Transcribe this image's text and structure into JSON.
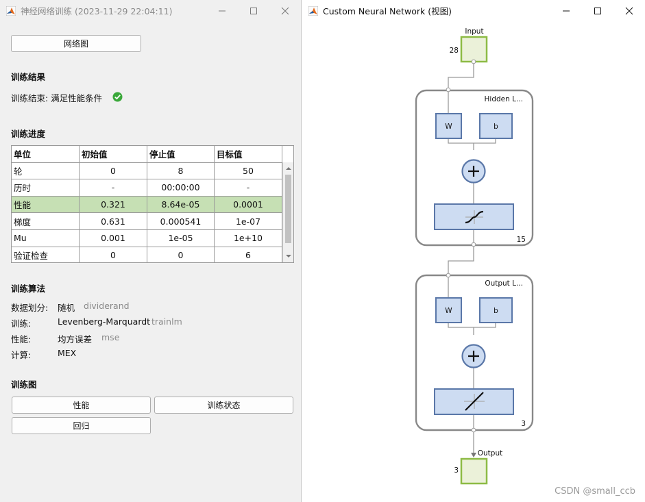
{
  "left_window": {
    "title": "神经网络训练 (2023-11-29 22:04:11)",
    "network_button": "网络图",
    "result_heading": "训练结果",
    "result_text": "训练结束: 满足性能条件",
    "progress_heading": "训练进度",
    "table": {
      "headers": [
        "单位",
        "初始值",
        "停止值",
        "目标值"
      ],
      "rows": [
        [
          "轮",
          "0",
          "8",
          "50"
        ],
        [
          "历时",
          "-",
          "00:00:00",
          "-"
        ],
        [
          "性能",
          "0.321",
          "8.64e-05",
          "0.0001"
        ],
        [
          "梯度",
          "0.631",
          "0.000541",
          "1e-07"
        ],
        [
          "Mu",
          "0.001",
          "1e-05",
          "1e+10"
        ],
        [
          "验证检查",
          "0",
          "0",
          "6"
        ]
      ],
      "highlight_color": "#c6e0b4"
    },
    "algo_heading": "训练算法",
    "algo": [
      {
        "label": "数据划分:",
        "value": "随机",
        "code": "dividerand"
      },
      {
        "label": "训练:",
        "value": "Levenberg-Marquardt",
        "code": "trainlm"
      },
      {
        "label": "性能:",
        "value": "均方误差",
        "code": "mse"
      },
      {
        "label": "计算:",
        "value": "MEX",
        "code": ""
      }
    ],
    "plots_heading": "训练图",
    "plot_buttons": {
      "performance": "性能",
      "train_state": "训练状态",
      "regression": "回归"
    }
  },
  "right_window": {
    "title": "Custom Neural Network (视图)",
    "input_label": "Input",
    "input_size": "28",
    "hidden_layer_label": "Hidden L...",
    "hidden_size": "15",
    "output_layer_label": "Output L...",
    "output_layer_size": "3",
    "output_label": "Output",
    "output_size": "3",
    "weight_label": "W",
    "bias_label": "b",
    "watermark": "CSDN @small_ccb"
  },
  "colors": {
    "check_green": "#3aa83a",
    "io_fill": "#ebf1d9",
    "io_border": "#8dbb45",
    "box_fill": "#cddcf2",
    "box_border": "#5a77a8",
    "layer_border": "#888888"
  }
}
